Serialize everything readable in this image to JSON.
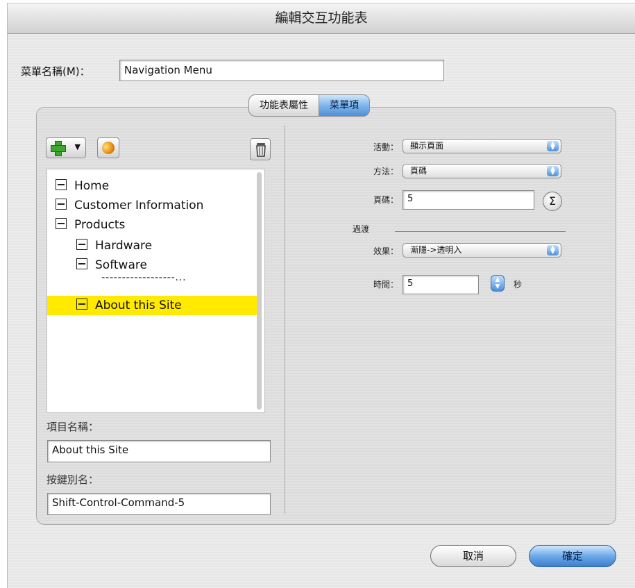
{
  "window": {
    "title": "編輯交互功能表"
  },
  "menu_name": {
    "label": "菜單名稱(M)：",
    "value": "Navigation Menu"
  },
  "tabs": [
    {
      "label": "功能表屬性",
      "active": false
    },
    {
      "label": "菜單項",
      "active": true
    }
  ],
  "toolbar": {
    "add_icon": "plus-icon",
    "link_icon": "link-icon",
    "delete_icon": "trash-icon"
  },
  "tree": {
    "items": [
      {
        "label": "Home"
      },
      {
        "label": "Customer Information"
      },
      {
        "label": "Products"
      },
      {
        "label": "Hardware"
      },
      {
        "label": "Software"
      },
      {
        "label": "About this Site"
      }
    ],
    "separator": "------------------..."
  },
  "item_name": {
    "label": "項目名稱：",
    "value": "About this Site"
  },
  "shortcut": {
    "label": "按鍵別名：",
    "value": "Shift-Control-Command-5"
  },
  "properties": {
    "action": {
      "label": "活動：",
      "value": "顯示頁面"
    },
    "method": {
      "label": "方法：",
      "value": "頁碼"
    },
    "page": {
      "label": "頁碼：",
      "value": "5"
    },
    "transition_label": "過渡",
    "effect": {
      "label": "效果：",
      "value": "漸隱->透明入"
    },
    "time": {
      "label": "時間：",
      "value": "5",
      "unit": "秒"
    }
  },
  "buttons": {
    "cancel": "取消",
    "ok": "確定"
  },
  "colors": {
    "selection": "#ffea00",
    "accent": "#4f90d8"
  }
}
